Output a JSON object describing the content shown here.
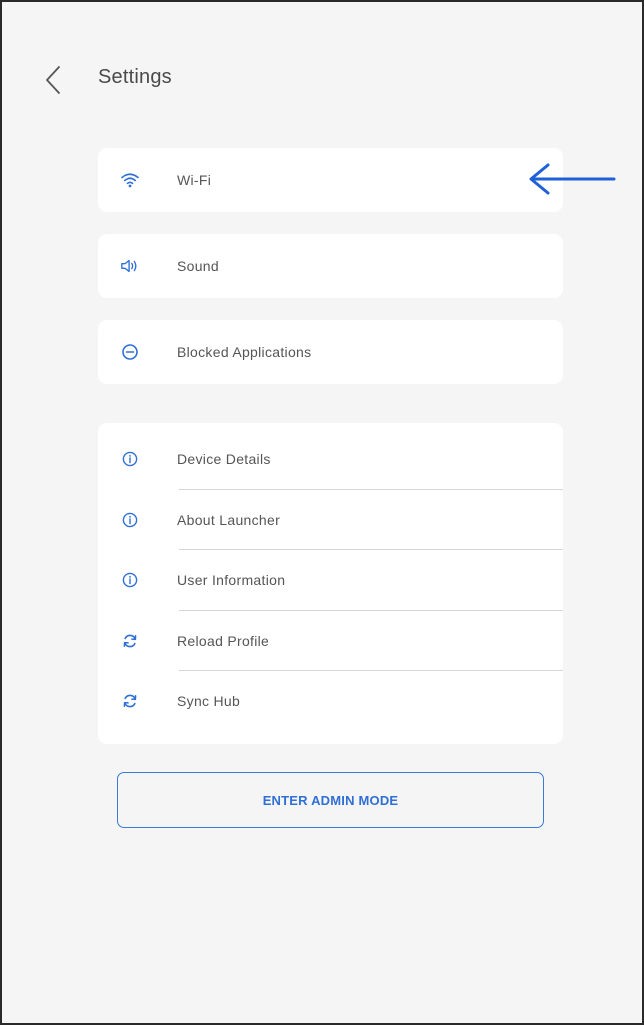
{
  "header": {
    "back_icon": "chevron-left-icon",
    "title": "Settings"
  },
  "primary_items": [
    {
      "label": "Wi-Fi",
      "icon": "wifi-icon"
    },
    {
      "label": "Sound",
      "icon": "speaker-icon"
    },
    {
      "label": "Blocked Applications",
      "icon": "minus-circle-icon"
    }
  ],
  "info_items": [
    {
      "label": "Device Details",
      "icon": "info-icon"
    },
    {
      "label": "About Launcher",
      "icon": "info-icon"
    },
    {
      "label": "User Information",
      "icon": "info-icon"
    },
    {
      "label": "Reload Profile",
      "icon": "refresh-icon"
    },
    {
      "label": "Sync Hub",
      "icon": "refresh-icon"
    }
  ],
  "admin_button": {
    "label": "ENTER ADMIN MODE"
  },
  "annotation": {
    "icon": "arrow-left-icon",
    "color": "#1f5fd8"
  },
  "colors": {
    "accent": "#2f6fd6",
    "background": "#f5f5f5",
    "card": "#ffffff",
    "text": "#555555"
  }
}
